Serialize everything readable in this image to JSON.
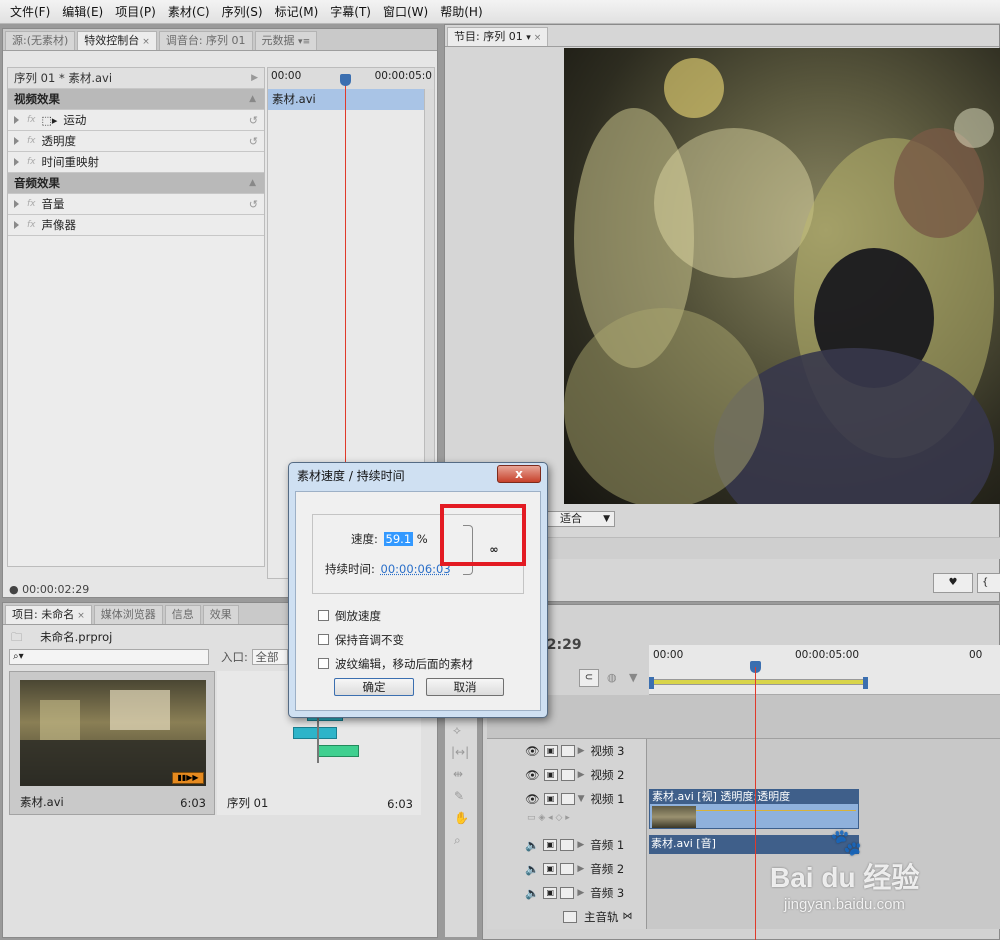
{
  "menu": [
    "文件(F)",
    "编辑(E)",
    "项目(P)",
    "素材(C)",
    "序列(S)",
    "标记(M)",
    "字幕(T)",
    "窗口(W)",
    "帮助(H)"
  ],
  "source_panel": {
    "tabs": [
      "源:(无素材)",
      "特效控制台",
      "调音台: 序列 01",
      "元数据"
    ],
    "clip_label": "序列 01 * 素材.avi",
    "ruler_start": "00:00",
    "ruler_end": "00:00:05:0",
    "clip_name": "素材.avi",
    "video_effects": "视频效果",
    "audio_effects": "音频效果",
    "effects": [
      "运动",
      "透明度",
      "时间重映射"
    ],
    "audio_items": [
      "音量",
      "声像器"
    ],
    "timecode": "00:00:02:29"
  },
  "program_panel": {
    "tab": "节目: 序列 01",
    "fit_label": "适合"
  },
  "project_panel": {
    "tabs": [
      "项目: 未命名",
      "媒体浏览器",
      "信息",
      "效果"
    ],
    "project_file": "未命名.prproj",
    "search_placeholder": "",
    "in_label": "入口:",
    "in_value": "全部",
    "items": [
      {
        "name": "素材.avi",
        "duration": "6:03"
      },
      {
        "name": "序列 01",
        "duration": "6:03"
      }
    ]
  },
  "timeline": {
    "timecode": "02:29",
    "ruler": [
      "00:00",
      "00:00:05:00",
      "00"
    ],
    "tracks": [
      {
        "name": "视频 3",
        "kind": "video"
      },
      {
        "name": "视频 2",
        "kind": "video"
      },
      {
        "name": "视频 1",
        "kind": "video",
        "clip": "素材.avi [视] 透明度:透明度"
      },
      {
        "name": "音频 1",
        "kind": "audio",
        "clip": "素材.avi [音]"
      },
      {
        "name": "音频 2",
        "kind": "audio"
      },
      {
        "name": "音频 3",
        "kind": "audio"
      },
      {
        "name": "主音轨",
        "kind": "master"
      }
    ]
  },
  "dialog": {
    "title": "素材速度 / 持续时间",
    "close": "x",
    "speed_label": "速度:",
    "speed_value": "59.1",
    "speed_unit": "%",
    "duration_label": "持续时间:",
    "duration_value": "00:00:06:03",
    "options": [
      "倒放速度",
      "保持音调不变",
      "波纹编辑，移动后面的素材"
    ],
    "ok": "确定",
    "cancel": "取消"
  },
  "watermark": {
    "brand": "Bai du 经验",
    "url": "jingyan.baidu.com"
  },
  "colors": {
    "accent": "#3b6fb0",
    "playhead": "#e03a2a",
    "highlight_box": "#e31b23",
    "clip_blue": "#8fb1dc"
  }
}
